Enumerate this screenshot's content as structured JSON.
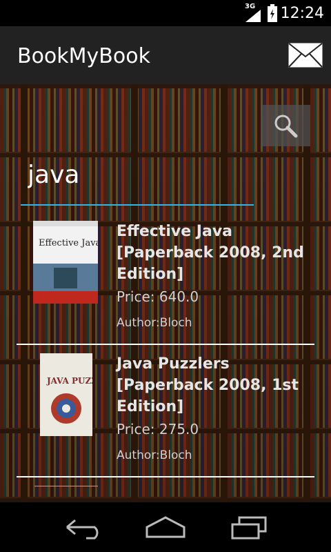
{
  "status_bar": {
    "network": "3G",
    "time": "12:24"
  },
  "action_bar": {
    "title": "BookMyBook",
    "mail_icon": "mail-icon"
  },
  "search": {
    "value": "java",
    "button_icon": "search-icon"
  },
  "books": [
    {
      "title": "Effective Java [Paperback 2008, 2nd Edition]",
      "price": "Price: 640.0",
      "author": "Author:Bloch",
      "cover_text": "Effective Java"
    },
    {
      "title": "Java Puzzlers [Paperback 2008, 1st Edition]",
      "price": "Price: 275.0",
      "author": "Author:Bloch",
      "cover_text": "JAVA PUZZLERS"
    }
  ],
  "nav": {
    "back_icon": "back-icon",
    "home_icon": "home-icon",
    "recents_icon": "recents-icon"
  }
}
